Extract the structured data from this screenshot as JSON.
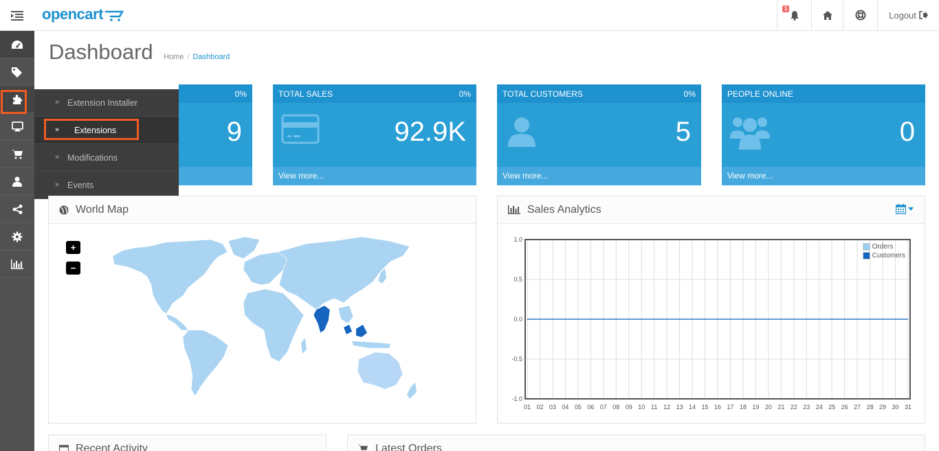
{
  "header": {
    "logo_text": "opencart",
    "notification_count": "1",
    "logout_label": "Logout"
  },
  "sidebar": {
    "icons": [
      "dashboard-icon",
      "tags-icon",
      "puzzle-icon",
      "desktop-icon",
      "cart-icon",
      "user-icon",
      "share-icon",
      "cog-icon",
      "bar-chart-icon"
    ]
  },
  "flyout": {
    "items": [
      {
        "label": "Extension Installer"
      },
      {
        "label": "Extensions"
      },
      {
        "label": "Modifications"
      },
      {
        "label": "Events"
      }
    ]
  },
  "page": {
    "title": "Dashboard",
    "breadcrumb": [
      "Home",
      "Dashboard"
    ]
  },
  "tiles": [
    {
      "title": "",
      "percent": "0%",
      "value": "9",
      "footer": ""
    },
    {
      "title": "TOTAL SALES",
      "percent": "0%",
      "value": "92.9K",
      "footer": "View more..."
    },
    {
      "title": "TOTAL CUSTOMERS",
      "percent": "0%",
      "value": "5",
      "footer": "View more..."
    },
    {
      "title": "PEOPLE ONLINE",
      "percent": "",
      "value": "0",
      "footer": "View more..."
    }
  ],
  "world_map": {
    "title": "World Map",
    "zoom_in": "+",
    "zoom_out": "−"
  },
  "sales_analytics": {
    "title": "Sales Analytics"
  },
  "chart_data": {
    "type": "line",
    "x": [
      "01",
      "02",
      "03",
      "04",
      "05",
      "06",
      "07",
      "08",
      "09",
      "10",
      "11",
      "12",
      "13",
      "14",
      "15",
      "16",
      "17",
      "18",
      "19",
      "20",
      "21",
      "22",
      "23",
      "24",
      "25",
      "26",
      "27",
      "28",
      "29",
      "30",
      "31"
    ],
    "yticks": [
      "1.0",
      "0.5",
      "0.0",
      "-0.5",
      "-1.0"
    ],
    "ylim": [
      -1.0,
      1.0
    ],
    "grid": true,
    "legend_position": "top-right",
    "series": [
      {
        "name": "Orders",
        "color": "#9bcdf0",
        "values": [
          0,
          0,
          0,
          0,
          0,
          0,
          0,
          0,
          0,
          0,
          0,
          0,
          0,
          0,
          0,
          0,
          0,
          0,
          0,
          0,
          0,
          0,
          0,
          0,
          0,
          0,
          0,
          0,
          0,
          0,
          0
        ]
      },
      {
        "name": "Customers",
        "color": "#1065c0",
        "values": [
          0,
          0,
          0,
          0,
          0,
          0,
          0,
          0,
          0,
          0,
          0,
          0,
          0,
          0,
          0,
          0,
          0,
          0,
          0,
          0,
          0,
          0,
          0,
          0,
          0,
          0,
          0,
          0,
          0,
          0,
          0
        ]
      }
    ]
  },
  "bottom_panels": {
    "recent_activity": "Recent Activity",
    "latest_orders": "Latest Orders"
  }
}
